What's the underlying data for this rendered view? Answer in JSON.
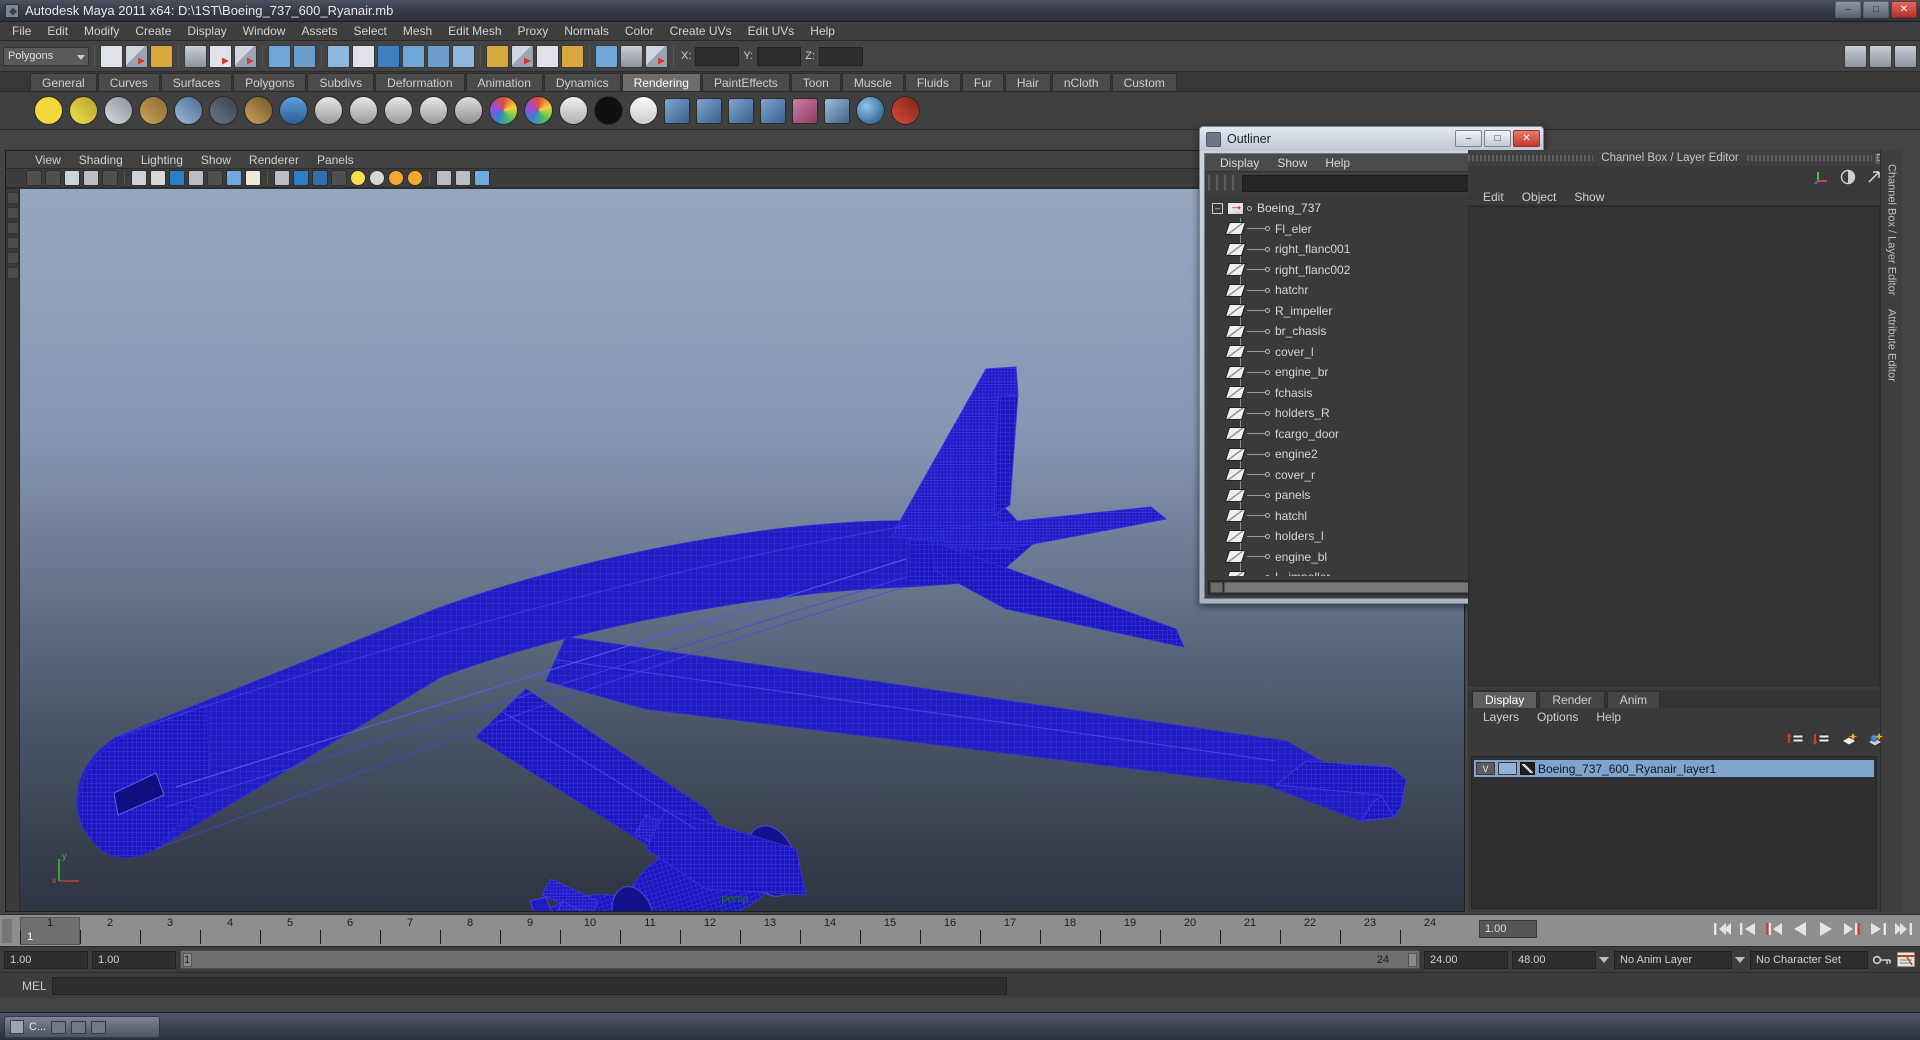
{
  "window": {
    "title": "Autodesk Maya 2011 x64: D:\\1ST\\Boeing_737_600_Ryanair.mb",
    "minimize": "–",
    "maximize": "□",
    "close": "✕",
    "app_icon": "maya-icon"
  },
  "menubar": {
    "items": [
      "File",
      "Edit",
      "Modify",
      "Create",
      "Display",
      "Window",
      "Assets",
      "Select",
      "Mesh",
      "Edit Mesh",
      "Proxy",
      "Normals",
      "Color",
      "Create UVs",
      "Edit UVs",
      "Help"
    ]
  },
  "statusbar": {
    "mode_selector": "Polygons",
    "axis_labels": [
      "X:",
      "Y:",
      "Z:"
    ]
  },
  "shelf_tabs": {
    "items": [
      "General",
      "Curves",
      "Surfaces",
      "Polygons",
      "Subdivs",
      "Deformation",
      "Animation",
      "Dynamics",
      "Rendering",
      "PaintEffects",
      "Toon",
      "Muscle",
      "Fluids",
      "Fur",
      "Hair",
      "nCloth",
      "Custom"
    ],
    "active": "Rendering"
  },
  "viewport": {
    "menus": [
      "View",
      "Shading",
      "Lighting",
      "Show",
      "Renderer",
      "Panels"
    ],
    "camera_label": "persp",
    "axis_labels": {
      "x": "x",
      "y": "y"
    },
    "wireframe_color": "#1b18c4",
    "bg_top": "#96a7c0",
    "bg_bottom": "#2e3440"
  },
  "outliner": {
    "title": "Outliner",
    "window_icon": "outliner-icon",
    "minimize": "–",
    "maximize": "□",
    "close": "✕",
    "menus": [
      "Display",
      "Show",
      "Help"
    ],
    "search_value": "",
    "root": "Boeing_737",
    "items": [
      "Fl_eler",
      "right_flanc001",
      "right_flanc002",
      "hatchr",
      "R_impeller",
      "br_chasis",
      "cover_l",
      "engine_br",
      "fchasis",
      "holders_R",
      "fcargo_door",
      "engine2",
      "cover_r",
      "panels",
      "hatchl",
      "holders_l",
      "engine_bl",
      "L_impeller"
    ]
  },
  "channel_box": {
    "title": "Channel Box / Layer Editor",
    "menus": [
      "Edit",
      "Object",
      "Show"
    ],
    "vertical_tabs": [
      "Channel Box / Layer Editor",
      "Attribute Editor"
    ],
    "undock": "❐",
    "close": "✕"
  },
  "layer_editor": {
    "tabs": [
      "Display",
      "Render",
      "Anim"
    ],
    "active_tab": "Display",
    "menus": [
      "Layers",
      "Options",
      "Help"
    ],
    "layers": [
      {
        "visibility": "V",
        "type": "",
        "name": "Boeing_737_600_Ryanair_layer1",
        "selected": true
      }
    ]
  },
  "timeline": {
    "current_frame": "1",
    "ticks": [
      "1",
      "2",
      "3",
      "4",
      "5",
      "6",
      "7",
      "8",
      "9",
      "10",
      "11",
      "12",
      "13",
      "14",
      "15",
      "16",
      "17",
      "18",
      "19",
      "20",
      "21",
      "22",
      "23",
      "24"
    ],
    "playback_speed_field": "1.00",
    "playback_buttons": [
      "go-to-start",
      "step-back-key",
      "step-back-frame",
      "play-backwards",
      "play-forwards",
      "step-forward-frame",
      "step-forward-key",
      "go-to-end"
    ]
  },
  "range_bar": {
    "anim_start": "1.00",
    "range_start": "1.00",
    "range_slider_left": "1",
    "range_slider_right": "24",
    "range_end": "24.00",
    "anim_end": "48.00",
    "anim_layer": "No Anim Layer",
    "character_set": "No Character Set",
    "key_icon": "key-icon",
    "auto_key_icon": "autokey-icon"
  },
  "mel_bar": {
    "label": "MEL",
    "command_value": "",
    "output_value": ""
  },
  "taskbar": {
    "button_label": "C...",
    "app_icon": "app-icon"
  }
}
